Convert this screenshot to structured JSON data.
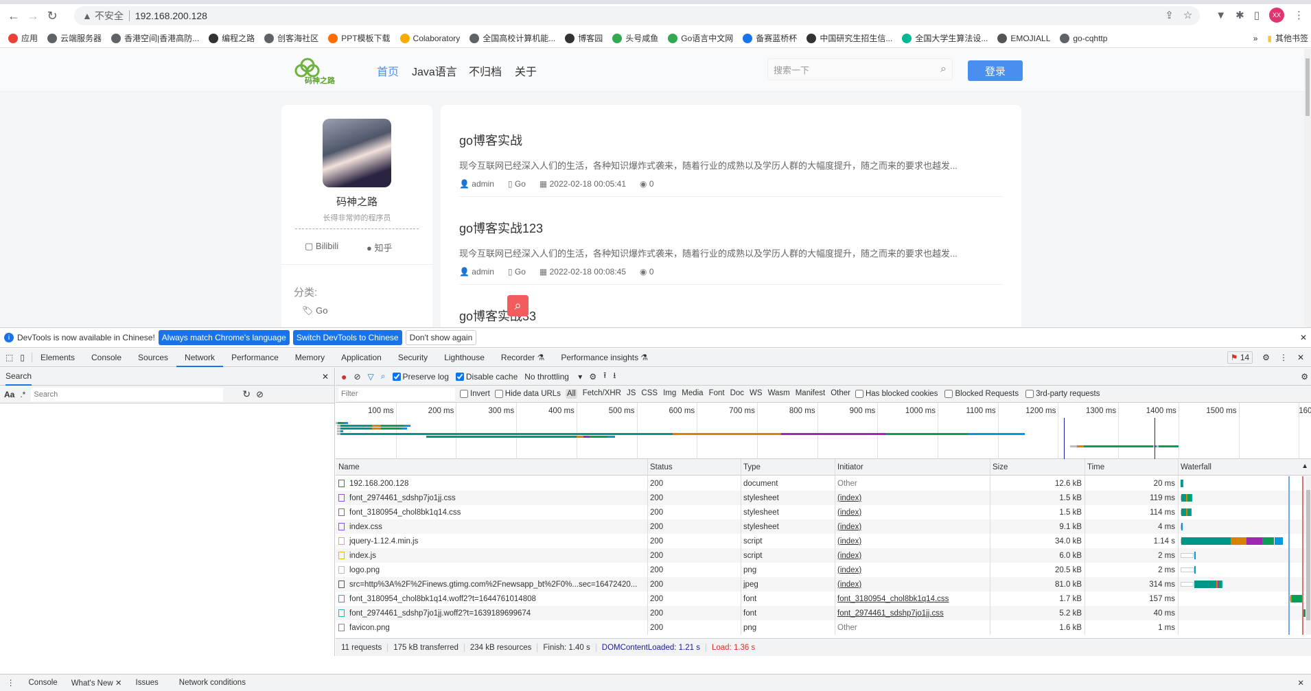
{
  "browser": {
    "security_label": "不安全",
    "url": "192.168.200.128",
    "profile": "XX",
    "bookmarks": [
      "应用",
      "云端服务器",
      "香港空间|香港高防...",
      "编程之路",
      "创客海社区",
      "PPT模板下载",
      "Colaboratory",
      "全国高校计算机能...",
      "博客园",
      "头号咸鱼",
      "Go语言中文网",
      "备赛蓝桥杯",
      "中国研究生招生信...",
      "全国大学生算法设...",
      "EMOJIALL",
      "go-cqhttp"
    ],
    "more": "»",
    "other_bookmarks": "其他书签"
  },
  "site": {
    "logo_text": "码神之路",
    "nav": [
      "首页",
      "Java语言",
      "不归档",
      "关于"
    ],
    "search_placeholder": "搜索一下",
    "login": "登录",
    "profile": {
      "name": "码神之路",
      "bio": "长得非常帅的程序员",
      "links": [
        "Bilibili",
        "知乎"
      ],
      "category_label": "分类:",
      "categories": [
        "Go"
      ]
    },
    "posts": [
      {
        "title": "go博客实战",
        "excerpt": "现今互联网已经深入人们的生活，各种知识爆炸式袭来，随着行业的成熟以及学历人群的大幅度提升，随之而来的要求也越发...",
        "author": "admin",
        "category": "Go",
        "date": "2022-02-18 00:05:41",
        "views": "0"
      },
      {
        "title": "go博客实战123",
        "excerpt": "现今互联网已经深入人们的生活，各种知识爆炸式袭来，随着行业的成熟以及学历人群的大幅度提升，随之而来的要求也越发...",
        "author": "admin",
        "category": "Go",
        "date": "2022-02-18 00:08:45",
        "views": "0"
      },
      {
        "title": "go博客实战33"
      }
    ]
  },
  "devtools": {
    "infobar": {
      "text": "DevTools is now available in Chinese!",
      "btn1": "Always match Chrome's language",
      "btn2": "Switch DevTools to Chinese",
      "btn3": "Don't show again"
    },
    "tabs": [
      "Elements",
      "Console",
      "Sources",
      "Network",
      "Performance",
      "Memory",
      "Application",
      "Security",
      "Lighthouse",
      "Recorder ⚗",
      "Performance insights ⚗"
    ],
    "active_tab": "Network",
    "issues_count": "14",
    "search": {
      "title": "Search",
      "case": "Aa",
      "regex": ".*",
      "placeholder": "Search"
    },
    "network": {
      "preserve_log": "Preserve log",
      "preserve_checked": true,
      "disable_cache": "Disable cache",
      "disable_checked": true,
      "throttling": "No throttling",
      "filter_placeholder": "Filter",
      "invert": "Invert",
      "hide_data": "Hide data URLs",
      "types": [
        "All",
        "Fetch/XHR",
        "JS",
        "CSS",
        "Img",
        "Media",
        "Font",
        "Doc",
        "WS",
        "Wasm",
        "Manifest",
        "Other"
      ],
      "extra_checks": [
        "Has blocked cookies",
        "Blocked Requests",
        "3rd-party requests"
      ],
      "ticks": [
        "100 ms",
        "200 ms",
        "300 ms",
        "400 ms",
        "500 ms",
        "600 ms",
        "700 ms",
        "800 ms",
        "900 ms",
        "1000 ms",
        "1100 ms",
        "1200 ms",
        "1300 ms",
        "1400 ms",
        "1500 ms",
        "160"
      ],
      "columns": [
        "Name",
        "Status",
        "Type",
        "Initiator",
        "Size",
        "Time",
        "Waterfall"
      ],
      "colors": {
        "queue": "#bdbdbd",
        "dns": "#009688",
        "connect": "#d68100",
        "ssl": "#9c27b0",
        "waiting": "#0a9d58",
        "download": "#0299de",
        "dcl": "#1a73e8",
        "load": "#d93025"
      },
      "dcl_ms": 1210,
      "load_ms": 1360,
      "rows": [
        {
          "name": "192.168.200.128",
          "icon": "document-icon",
          "ic": "#1a73e8",
          "status": "200",
          "type": "document",
          "initiator": "Other",
          "link": false,
          "size": "12.6 kB",
          "time": "20 ms",
          "wf": [
            [
              0,
              3,
              "queue"
            ],
            [
              3,
              15,
              "waiting"
            ],
            [
              15,
              20,
              "download"
            ]
          ]
        },
        {
          "name": "font_2974461_sdshp7jo1jj.css",
          "icon": "stylesheet-icon",
          "ic": "#a142f4",
          "status": "200",
          "type": "stylesheet",
          "initiator": "(index)",
          "link": true,
          "size": "1.5 kB",
          "time": "119 ms",
          "wf": [
            [
              2,
              8,
              "queue"
            ],
            [
              8,
              60,
              "dns"
            ],
            [
              60,
              75,
              "connect"
            ],
            [
              75,
              112,
              "waiting"
            ],
            [
              112,
              124,
              "download"
            ]
          ]
        },
        {
          "name": "font_3180954_chol8bk1q14.css",
          "icon": "stylesheet-icon",
          "ic": "#a142f4",
          "status": "200",
          "type": "stylesheet",
          "initiator": "(index)",
          "link": true,
          "size": "1.5 kB",
          "time": "114 ms",
          "wf": [
            [
              2,
              8,
              "queue"
            ],
            [
              8,
              60,
              "dns"
            ],
            [
              60,
              75,
              "connect"
            ],
            [
              75,
              110,
              "waiting"
            ],
            [
              110,
              119,
              "download"
            ]
          ]
        },
        {
          "name": "index.css",
          "icon": "stylesheet-icon",
          "ic": "#a142f4",
          "status": "200",
          "type": "stylesheet",
          "initiator": "(index)",
          "link": true,
          "size": "9.1 kB",
          "time": "4 ms",
          "wf": [
            [
              2,
              8,
              "queue"
            ],
            [
              8,
              12,
              "download"
            ]
          ]
        },
        {
          "name": "jquery-1.12.4.min.js",
          "icon": "script-icon",
          "ic": "#f4b400",
          "status": "200",
          "type": "script",
          "initiator": "(index)",
          "link": true,
          "size": "34.0 kB",
          "time": "1.14 s",
          "wf": [
            [
              2,
              8,
              "queue"
            ],
            [
              8,
              560,
              "dns"
            ],
            [
              560,
              740,
              "connect"
            ],
            [
              740,
              915,
              "ssl"
            ],
            [
              915,
              1050,
              "waiting"
            ],
            [
              1050,
              1145,
              "download"
            ]
          ]
        },
        {
          "name": "index.js",
          "icon": "script-icon",
          "ic": "#f4b400",
          "status": "200",
          "type": "script",
          "initiator": "(index)",
          "link": true,
          "size": "6.0 kB",
          "time": "2 ms",
          "wf": [
            [
              2,
              150,
              "idle"
            ],
            [
              150,
              155,
              "download"
            ]
          ]
        },
        {
          "name": "logo.png",
          "icon": "image-icon",
          "ic": "#bbb",
          "status": "200",
          "type": "png",
          "initiator": "(index)",
          "link": true,
          "size": "20.5 kB",
          "time": "2 ms",
          "wf": [
            [
              2,
              155,
              "idle"
            ],
            [
              155,
              160,
              "download"
            ]
          ]
        },
        {
          "name": "src=http%3A%2F%2Finews.gtimg.com%2Fnewsapp_bt%2F0%...sec=16472420...",
          "icon": "image-icon",
          "ic": "#555",
          "status": "200",
          "type": "jpeg",
          "initiator": "(index)",
          "link": true,
          "size": "81.0 kB",
          "time": "314 ms",
          "wf": [
            [
              2,
              150,
              "idle"
            ],
            [
              150,
              400,
              "dns"
            ],
            [
              400,
              412,
              "connect"
            ],
            [
              412,
              422,
              "ssl"
            ],
            [
              422,
              452,
              "waiting"
            ],
            [
              452,
              464,
              "download"
            ]
          ]
        },
        {
          "name": "font_3180954_chol8bk1q14.woff2?t=1644761014808",
          "icon": "font-icon",
          "ic": "#12b5cb",
          "status": "200",
          "type": "font",
          "initiator": "font_3180954_chol8bk1q14.css",
          "link": true,
          "size": "1.7 kB",
          "time": "157 ms",
          "wf": [
            [
              1220,
              1232,
              "queue"
            ],
            [
              1232,
              1243,
              "connect"
            ],
            [
              1243,
              1365,
              "waiting"
            ],
            [
              1365,
              1377,
              "download"
            ]
          ]
        },
        {
          "name": "font_2974461_sdshp7jo1jj.woff2?t=1639189699674",
          "icon": "font-icon",
          "ic": "#12b5cb",
          "status": "200",
          "type": "font",
          "initiator": "font_2974461_sdshp7jo1jj.css",
          "link": true,
          "size": "5.2 kB",
          "time": "40 ms",
          "wf": [
            [
              1360,
              1367,
              "queue"
            ],
            [
              1367,
              1400,
              "waiting"
            ]
          ]
        },
        {
          "name": "favicon.png",
          "icon": "file-icon",
          "ic": "#888",
          "status": "200",
          "type": "png",
          "initiator": "Other",
          "link": false,
          "size": "1.6 kB",
          "time": "1 ms",
          "wf": [
            [
              1358,
              1362,
              "queue"
            ],
            [
              1362,
              1364,
              "download"
            ]
          ]
        }
      ],
      "summary": {
        "requests": "11 requests",
        "transferred": "175 kB transferred",
        "resources": "234 kB resources",
        "finish": "Finish: 1.40 s",
        "dcl": "DOMContentLoaded: 1.21 s",
        "load": "Load: 1.36 s"
      }
    },
    "drawer": [
      "Console",
      "What's New",
      "Issues",
      "Network conditions"
    ]
  }
}
